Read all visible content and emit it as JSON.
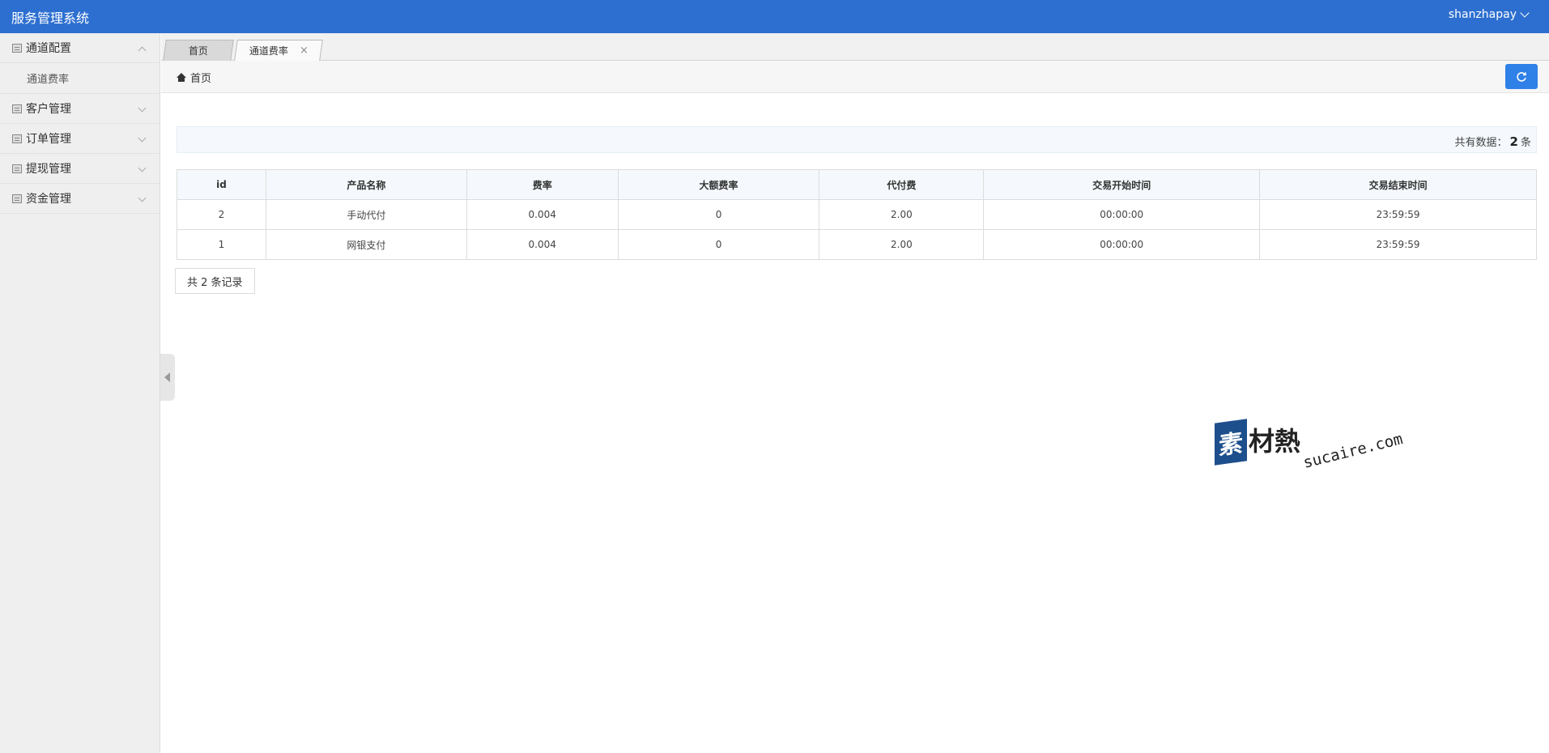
{
  "header": {
    "app_title": "服务管理系统",
    "username": "shanzhapay"
  },
  "sidebar": {
    "items": [
      {
        "label": "通道配置",
        "expanded": true,
        "children": [
          {
            "label": "通道费率"
          }
        ]
      },
      {
        "label": "客户管理",
        "expanded": false
      },
      {
        "label": "订单管理",
        "expanded": false
      },
      {
        "label": "提现管理",
        "expanded": false
      },
      {
        "label": "资金管理",
        "expanded": false
      }
    ]
  },
  "tabs": [
    {
      "label": "首页",
      "active": false
    },
    {
      "label": "通道费率",
      "active": true,
      "close": "×"
    }
  ],
  "breadcrumb": {
    "label": "首页"
  },
  "summary": {
    "prefix": "共有数据：",
    "count": "2",
    "suffix": "条"
  },
  "table": {
    "columns": [
      "id",
      "产品名称",
      "费率",
      "大额费率",
      "代付费",
      "交易开始时间",
      "交易结束时间"
    ],
    "rows": [
      [
        "2",
        "手动代付",
        "0.004",
        "0",
        "2.00",
        "00:00:00",
        "23:59:59"
      ],
      [
        "1",
        "网银支付",
        "0.004",
        "0",
        "2.00",
        "00:00:00",
        "23:59:59"
      ]
    ]
  },
  "pager": {
    "text": "共 2 条记录"
  },
  "watermark": {
    "badge": "素",
    "text": "材熱",
    "url": "sucaire.com"
  },
  "colors": {
    "header_bg": "#2d6fd0",
    "primary_button": "#2f80e7",
    "sidebar_bg": "#efefef"
  }
}
